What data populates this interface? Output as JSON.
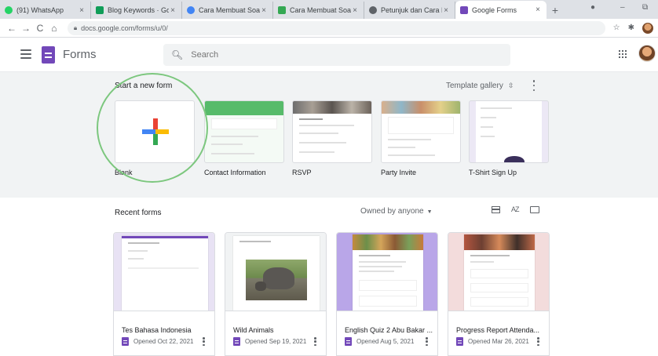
{
  "browser": {
    "tabs": [
      {
        "title": "(91) WhatsApp",
        "color": "#25d366"
      },
      {
        "title": "Blog Keywords · Goo",
        "color": "#0f9d58"
      },
      {
        "title": "Cara Membuat Soal d",
        "color": "#4285f4"
      },
      {
        "title": "Cara Membuat Soal O",
        "color": "#34a853"
      },
      {
        "title": "Petunjuk dan Cara Mi",
        "color": "#5f6368"
      },
      {
        "title": "Google Forms",
        "color": "#7248b9",
        "active": true
      }
    ],
    "new_tab_symbol": "+",
    "window_controls": {
      "minimize": "–",
      "restore": "⧉"
    },
    "address": "docs.google.com/forms/u/0/",
    "nav": {
      "back": "←",
      "forward": "→",
      "reload": "C",
      "home": "⌂"
    },
    "star_symbol": "☆",
    "puzzle_symbol": "✱"
  },
  "header": {
    "app_name": "Forms",
    "search_placeholder": "Search"
  },
  "templates": {
    "title": "Start a new form",
    "gallery_label": "Template gallery",
    "gallery_chevron": "⇳",
    "items": [
      {
        "label": "Blank"
      },
      {
        "label": "Contact Information"
      },
      {
        "label": "RSVP"
      },
      {
        "label": "Party Invite"
      },
      {
        "label": "T-Shirt Sign Up"
      }
    ]
  },
  "recent": {
    "title": "Recent forms",
    "owner_filter": "Owned by anyone",
    "owner_caret": "▼",
    "sort_label": "AZ",
    "forms": [
      {
        "title": "Tes Bahasa Indonesia",
        "opened": "Opened Oct 22, 2021"
      },
      {
        "title": "Wild Animals",
        "opened": "Opened Sep 19, 2021"
      },
      {
        "title": "English Quiz 2 Abu Bakar ...",
        "opened": "Opened Aug 5, 2021"
      },
      {
        "title": "Progress Report Attenda...",
        "opened": "Opened Mar 26, 2021"
      }
    ]
  },
  "colors": {
    "forms_purple": "#7248b9",
    "highlight_ring": "#7cc77e",
    "contact_green": "#57bb6a",
    "tshirt_lavender": "#b4a7d6"
  }
}
